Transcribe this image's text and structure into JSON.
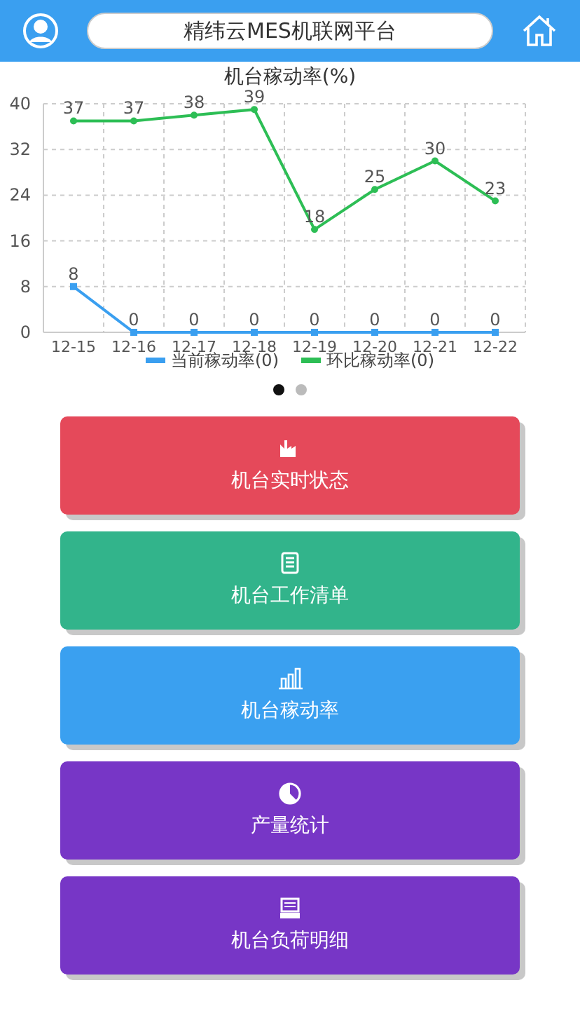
{
  "header": {
    "title": "精纬云MES机联网平台"
  },
  "chart": {
    "chart_data": {
      "type": "line",
      "title": "机台稼动率(%)",
      "categories": [
        "12-15",
        "12-16",
        "12-17",
        "12-18",
        "12-19",
        "12-20",
        "12-21",
        "12-22"
      ],
      "series": [
        {
          "name": "当前稼动率(0)",
          "color": "#3a9ff0",
          "marker": "square",
          "values": [
            8,
            0,
            0,
            0,
            0,
            0,
            0,
            0
          ]
        },
        {
          "name": "环比稼动率(0)",
          "color": "#2dbe55",
          "marker": "circle",
          "values": [
            37,
            37,
            38,
            39,
            18,
            25,
            30,
            23
          ]
        }
      ],
      "ylim": [
        0,
        40
      ],
      "yticks": [
        0,
        8,
        16,
        24,
        32,
        40
      ],
      "data_labels": true,
      "grid": true
    }
  },
  "pager": [
    {
      "selected": true
    },
    {
      "selected": false
    }
  ],
  "menu": [
    {
      "label": "机台实时状态",
      "kind": "factory",
      "color": "#e5495a"
    },
    {
      "label": "机台工作清单",
      "kind": "list",
      "color": "#32b48b"
    },
    {
      "label": "机台稼动率",
      "kind": "bars",
      "color": "#3aa0f0"
    },
    {
      "label": "产量统计",
      "kind": "pie",
      "color": "#7736c6"
    },
    {
      "label": "机台负荷明细",
      "kind": "device",
      "color": "#7736c6"
    }
  ]
}
